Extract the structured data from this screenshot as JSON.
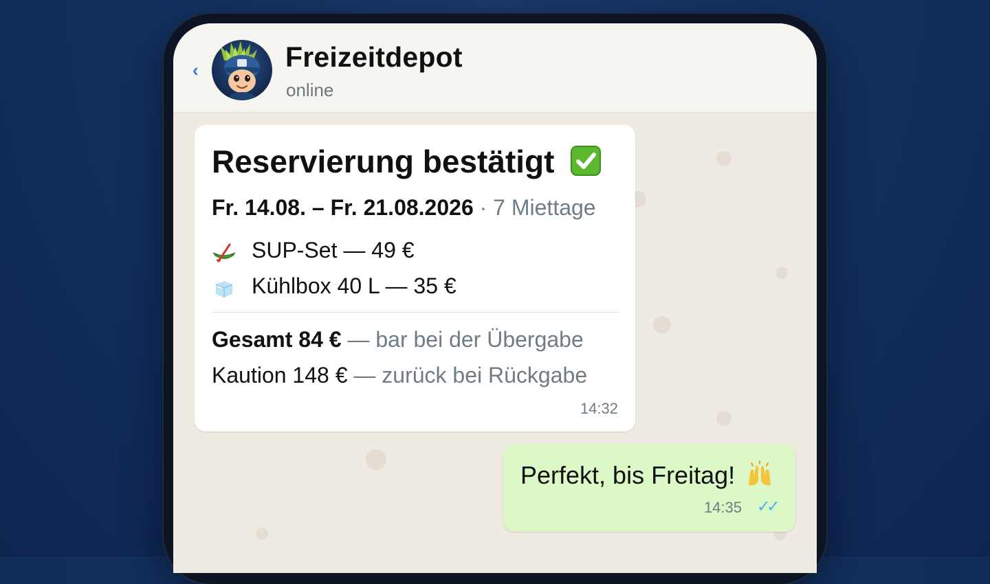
{
  "chat": {
    "back_icon": "chevron-left-icon",
    "contact_name": "Freizeitdepot",
    "contact_status": "online",
    "avatar": "mascot-avatar"
  },
  "incoming_message": {
    "heading": "Reservierung bestätigt",
    "heading_icon": "check-mark-button-emoji",
    "date_range": "Fr. 14.08. – Fr. 21.08.2026",
    "rental_days": "· 7 Miettage",
    "items": [
      {
        "icon": "canoe-emoji",
        "label": "SUP-Set — 49 €"
      },
      {
        "icon": "ice-cube-emoji",
        "label": "Kühlbox 40 L — 35 €"
      }
    ],
    "total_label": "Gesamt 84 €",
    "total_note": "— bar bei der Übergabe",
    "deposit_label": "Kaution 148 €",
    "deposit_note": "— zurück bei Rückgabe",
    "time": "14:32"
  },
  "outgoing_message": {
    "text": "Perfekt, bis Freitag!",
    "emoji": "raising-hands-emoji",
    "time": "14:35",
    "read_status": "read-double-check-icon"
  },
  "colors": {
    "background": "#12305f",
    "chat_background": "#efeae2",
    "incoming_bubble": "#ffffff",
    "outgoing_bubble": "#dcf8c7",
    "read_ticks": "#4fb3f0",
    "link_blue": "#2f7bd8"
  }
}
